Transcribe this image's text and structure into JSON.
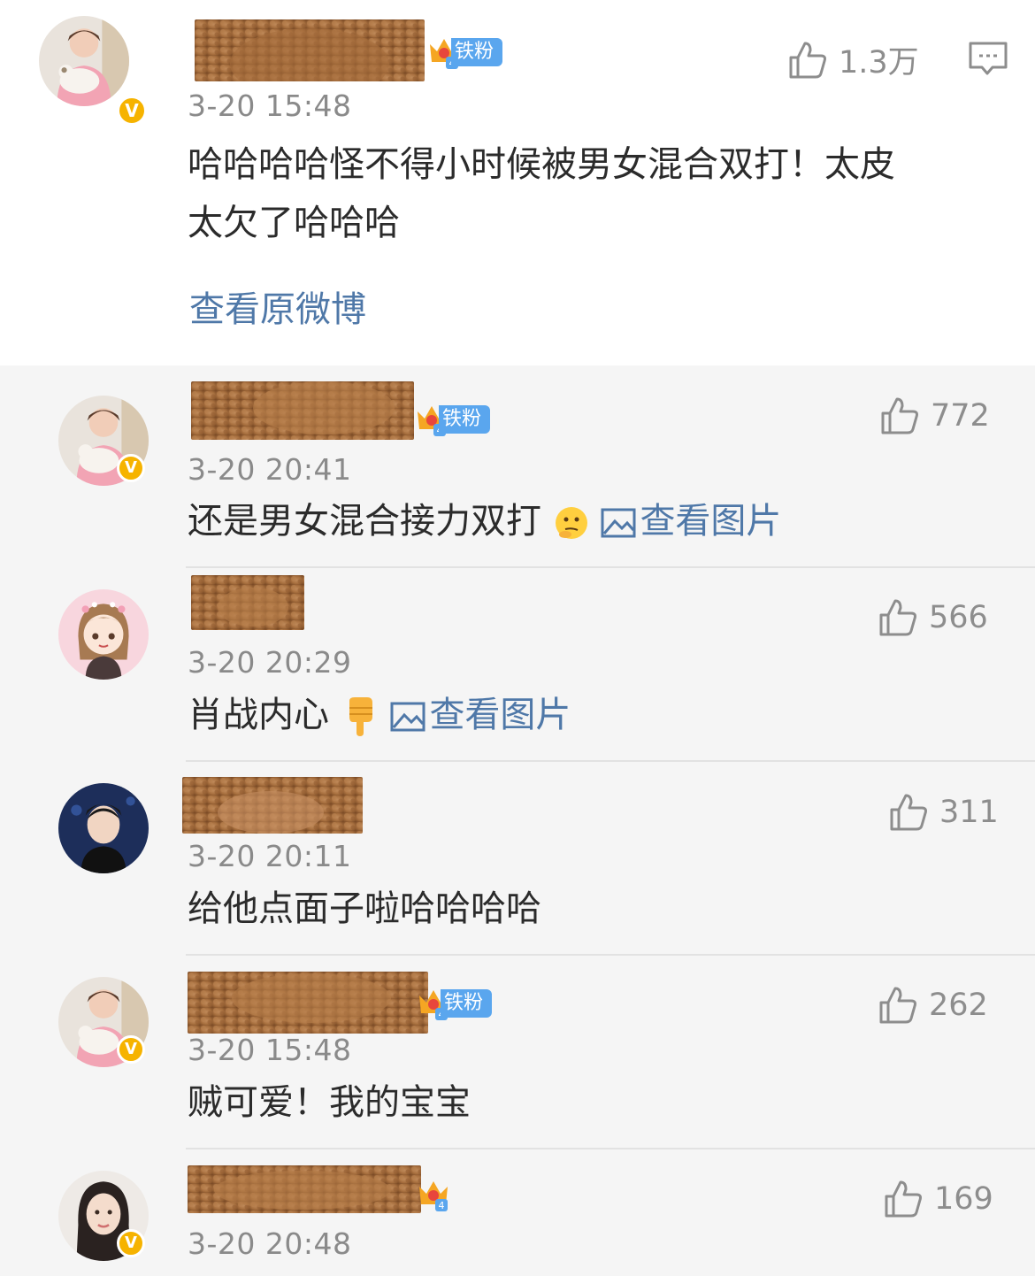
{
  "main_comment": {
    "fan_label": "铁粉",
    "time": "3-20 15:48",
    "text_line1": "哈哈哈哈怪不得小时候被男女混合双打！太皮",
    "text_line2": "太欠了哈哈哈",
    "like_count": "1.3万",
    "view_original": "查看原微博",
    "crown_level": "4"
  },
  "replies": [
    {
      "fan_label": "铁粉",
      "time": "3-20 20:41",
      "text": "还是男女混合接力双打",
      "emoji": "thinking-emoji",
      "link": "查看图片",
      "like_count": "772",
      "crown_level": "4"
    },
    {
      "time": "3-20 20:29",
      "text": "肖战内心",
      "emoji": "pointing-down-emoji",
      "link": "查看图片",
      "like_count": "566"
    },
    {
      "time": "3-20 20:11",
      "text": "给他点面子啦哈哈哈哈",
      "like_count": "311"
    },
    {
      "fan_label": "铁粉",
      "time": "3-20 15:48",
      "text": "贼可爱！我的宝宝",
      "like_count": "262",
      "crown_level": "4"
    },
    {
      "time": "3-20 20:48",
      "like_count": "169",
      "crown_level": "4"
    }
  ],
  "colors": {
    "link": "#4f78a8",
    "fan_badge": "#5aa6ee",
    "verified": "#f6b300",
    "like_gray": "#8d8d8d"
  },
  "icons": [
    "thumbs-up-icon",
    "comment-icon",
    "image-icon",
    "crown-icon",
    "verified-icon"
  ]
}
